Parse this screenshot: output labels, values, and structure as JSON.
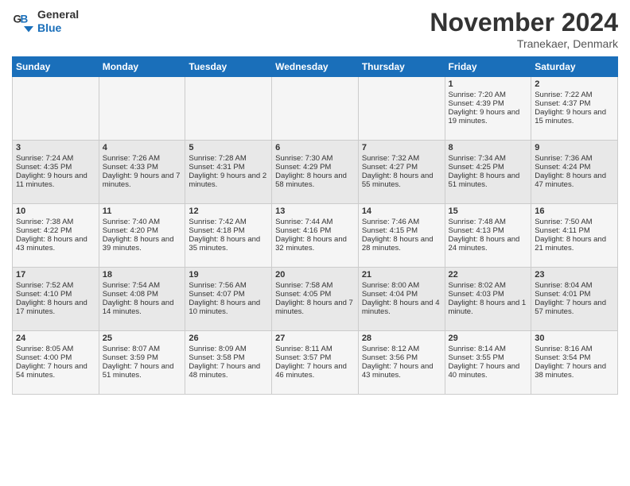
{
  "logo": {
    "line1": "General",
    "line2": "Blue"
  },
  "title": "November 2024",
  "location": "Tranekaer, Denmark",
  "days_of_week": [
    "Sunday",
    "Monday",
    "Tuesday",
    "Wednesday",
    "Thursday",
    "Friday",
    "Saturday"
  ],
  "weeks": [
    [
      {
        "day": "",
        "sunrise": "",
        "sunset": "",
        "daylight": ""
      },
      {
        "day": "",
        "sunrise": "",
        "sunset": "",
        "daylight": ""
      },
      {
        "day": "",
        "sunrise": "",
        "sunset": "",
        "daylight": ""
      },
      {
        "day": "",
        "sunrise": "",
        "sunset": "",
        "daylight": ""
      },
      {
        "day": "",
        "sunrise": "",
        "sunset": "",
        "daylight": ""
      },
      {
        "day": "1",
        "sunrise": "Sunrise: 7:20 AM",
        "sunset": "Sunset: 4:39 PM",
        "daylight": "Daylight: 9 hours and 19 minutes."
      },
      {
        "day": "2",
        "sunrise": "Sunrise: 7:22 AM",
        "sunset": "Sunset: 4:37 PM",
        "daylight": "Daylight: 9 hours and 15 minutes."
      }
    ],
    [
      {
        "day": "3",
        "sunrise": "Sunrise: 7:24 AM",
        "sunset": "Sunset: 4:35 PM",
        "daylight": "Daylight: 9 hours and 11 minutes."
      },
      {
        "day": "4",
        "sunrise": "Sunrise: 7:26 AM",
        "sunset": "Sunset: 4:33 PM",
        "daylight": "Daylight: 9 hours and 7 minutes."
      },
      {
        "day": "5",
        "sunrise": "Sunrise: 7:28 AM",
        "sunset": "Sunset: 4:31 PM",
        "daylight": "Daylight: 9 hours and 2 minutes."
      },
      {
        "day": "6",
        "sunrise": "Sunrise: 7:30 AM",
        "sunset": "Sunset: 4:29 PM",
        "daylight": "Daylight: 8 hours and 58 minutes."
      },
      {
        "day": "7",
        "sunrise": "Sunrise: 7:32 AM",
        "sunset": "Sunset: 4:27 PM",
        "daylight": "Daylight: 8 hours and 55 minutes."
      },
      {
        "day": "8",
        "sunrise": "Sunrise: 7:34 AM",
        "sunset": "Sunset: 4:25 PM",
        "daylight": "Daylight: 8 hours and 51 minutes."
      },
      {
        "day": "9",
        "sunrise": "Sunrise: 7:36 AM",
        "sunset": "Sunset: 4:24 PM",
        "daylight": "Daylight: 8 hours and 47 minutes."
      }
    ],
    [
      {
        "day": "10",
        "sunrise": "Sunrise: 7:38 AM",
        "sunset": "Sunset: 4:22 PM",
        "daylight": "Daylight: 8 hours and 43 minutes."
      },
      {
        "day": "11",
        "sunrise": "Sunrise: 7:40 AM",
        "sunset": "Sunset: 4:20 PM",
        "daylight": "Daylight: 8 hours and 39 minutes."
      },
      {
        "day": "12",
        "sunrise": "Sunrise: 7:42 AM",
        "sunset": "Sunset: 4:18 PM",
        "daylight": "Daylight: 8 hours and 35 minutes."
      },
      {
        "day": "13",
        "sunrise": "Sunrise: 7:44 AM",
        "sunset": "Sunset: 4:16 PM",
        "daylight": "Daylight: 8 hours and 32 minutes."
      },
      {
        "day": "14",
        "sunrise": "Sunrise: 7:46 AM",
        "sunset": "Sunset: 4:15 PM",
        "daylight": "Daylight: 8 hours and 28 minutes."
      },
      {
        "day": "15",
        "sunrise": "Sunrise: 7:48 AM",
        "sunset": "Sunset: 4:13 PM",
        "daylight": "Daylight: 8 hours and 24 minutes."
      },
      {
        "day": "16",
        "sunrise": "Sunrise: 7:50 AM",
        "sunset": "Sunset: 4:11 PM",
        "daylight": "Daylight: 8 hours and 21 minutes."
      }
    ],
    [
      {
        "day": "17",
        "sunrise": "Sunrise: 7:52 AM",
        "sunset": "Sunset: 4:10 PM",
        "daylight": "Daylight: 8 hours and 17 minutes."
      },
      {
        "day": "18",
        "sunrise": "Sunrise: 7:54 AM",
        "sunset": "Sunset: 4:08 PM",
        "daylight": "Daylight: 8 hours and 14 minutes."
      },
      {
        "day": "19",
        "sunrise": "Sunrise: 7:56 AM",
        "sunset": "Sunset: 4:07 PM",
        "daylight": "Daylight: 8 hours and 10 minutes."
      },
      {
        "day": "20",
        "sunrise": "Sunrise: 7:58 AM",
        "sunset": "Sunset: 4:05 PM",
        "daylight": "Daylight: 8 hours and 7 minutes."
      },
      {
        "day": "21",
        "sunrise": "Sunrise: 8:00 AM",
        "sunset": "Sunset: 4:04 PM",
        "daylight": "Daylight: 8 hours and 4 minutes."
      },
      {
        "day": "22",
        "sunrise": "Sunrise: 8:02 AM",
        "sunset": "Sunset: 4:03 PM",
        "daylight": "Daylight: 8 hours and 1 minute."
      },
      {
        "day": "23",
        "sunrise": "Sunrise: 8:04 AM",
        "sunset": "Sunset: 4:01 PM",
        "daylight": "Daylight: 7 hours and 57 minutes."
      }
    ],
    [
      {
        "day": "24",
        "sunrise": "Sunrise: 8:05 AM",
        "sunset": "Sunset: 4:00 PM",
        "daylight": "Daylight: 7 hours and 54 minutes."
      },
      {
        "day": "25",
        "sunrise": "Sunrise: 8:07 AM",
        "sunset": "Sunset: 3:59 PM",
        "daylight": "Daylight: 7 hours and 51 minutes."
      },
      {
        "day": "26",
        "sunrise": "Sunrise: 8:09 AM",
        "sunset": "Sunset: 3:58 PM",
        "daylight": "Daylight: 7 hours and 48 minutes."
      },
      {
        "day": "27",
        "sunrise": "Sunrise: 8:11 AM",
        "sunset": "Sunset: 3:57 PM",
        "daylight": "Daylight: 7 hours and 46 minutes."
      },
      {
        "day": "28",
        "sunrise": "Sunrise: 8:12 AM",
        "sunset": "Sunset: 3:56 PM",
        "daylight": "Daylight: 7 hours and 43 minutes."
      },
      {
        "day": "29",
        "sunrise": "Sunrise: 8:14 AM",
        "sunset": "Sunset: 3:55 PM",
        "daylight": "Daylight: 7 hours and 40 minutes."
      },
      {
        "day": "30",
        "sunrise": "Sunrise: 8:16 AM",
        "sunset": "Sunset: 3:54 PM",
        "daylight": "Daylight: 7 hours and 38 minutes."
      }
    ]
  ]
}
